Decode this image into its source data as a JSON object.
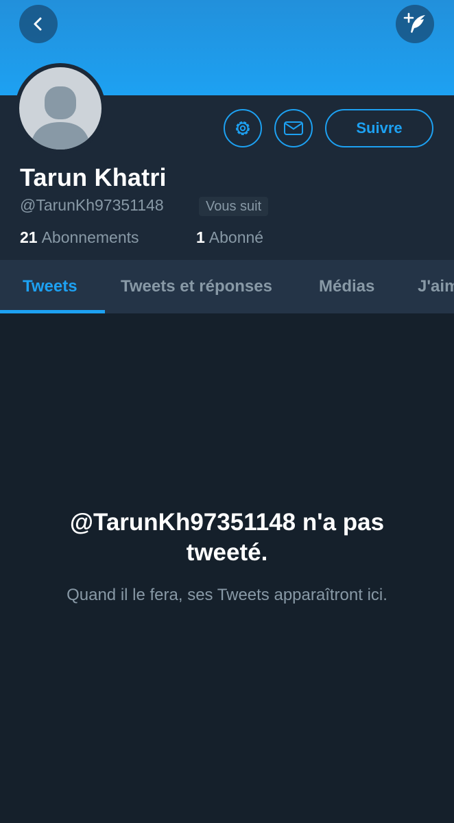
{
  "colors": {
    "accent": "#1da1f2",
    "background": "#15202b",
    "header_background": "#1c2938",
    "tab_bar_background": "#243447",
    "secondary_text": "#8899a6"
  },
  "header": {
    "back_icon": "chevron-left-icon",
    "compose_icon": "compose-tweet-icon"
  },
  "profile": {
    "avatar_icon": "default-avatar-icon",
    "display_name": "Tarun Khatri",
    "handle": "@TarunKh97351148",
    "follows_you_badge": "Vous suit",
    "following_count": "21",
    "following_label": "Abonnements",
    "followers_count": "1",
    "followers_label": "Abonné"
  },
  "actions": {
    "settings_icon": "gear-icon",
    "message_icon": "envelope-icon",
    "follow_label": "Suivre"
  },
  "tabs": [
    {
      "label": "Tweets",
      "active": true
    },
    {
      "label": "Tweets et réponses",
      "active": false
    },
    {
      "label": "Médias",
      "active": false
    },
    {
      "label": "J'aime",
      "active": false
    }
  ],
  "empty_state": {
    "title": "@TarunKh97351148 n'a pas tweeté.",
    "subtitle": "Quand il le fera, ses Tweets apparaîtront ici."
  }
}
